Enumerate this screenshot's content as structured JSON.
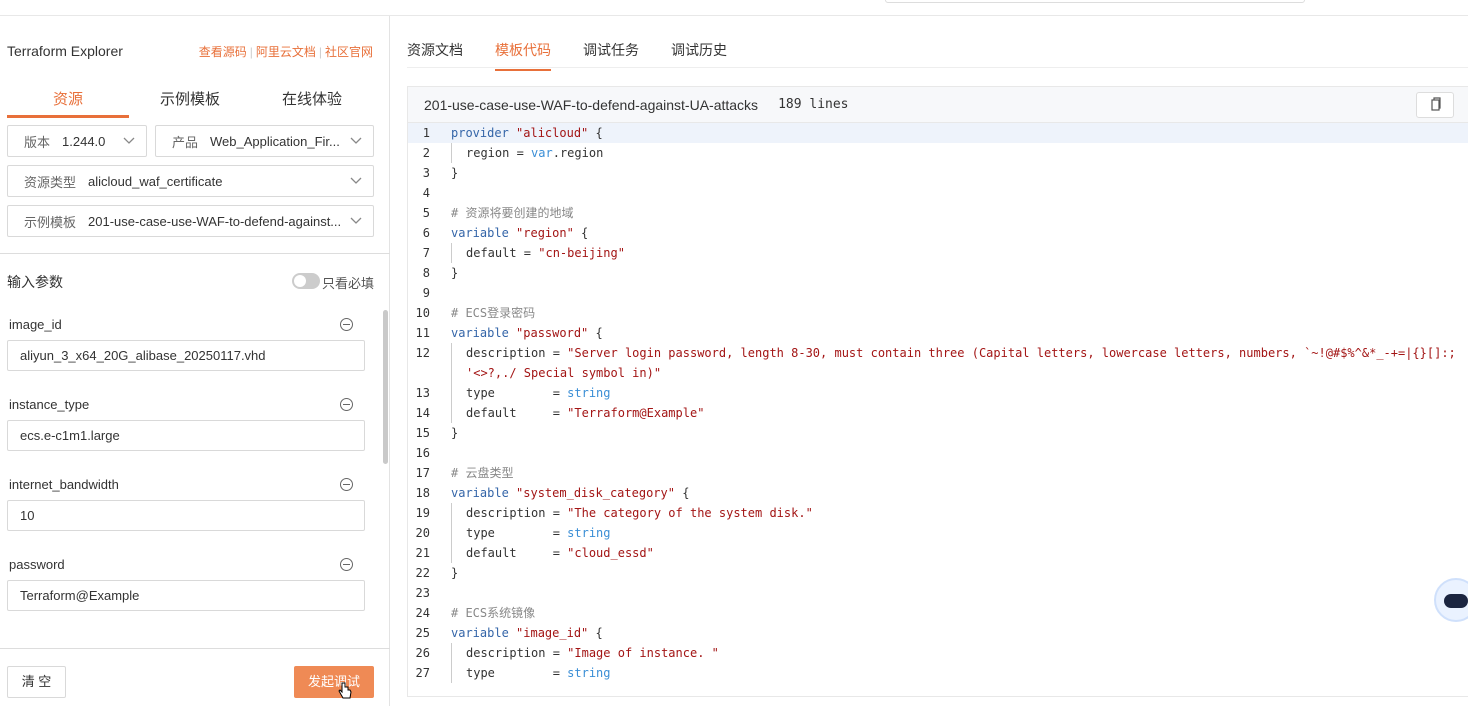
{
  "header": {
    "brand": "Terraform Explorer",
    "links": [
      "查看源码",
      "阿里云文档",
      "社区官网"
    ]
  },
  "left_tabs": [
    "资源",
    "示例模板",
    "在线体验"
  ],
  "selects": {
    "version": {
      "label": "版本",
      "value": "1.244.0"
    },
    "product": {
      "label": "产品",
      "value": "Web_Application_Fir..."
    },
    "resource_type": {
      "label": "资源类型",
      "value": "alicloud_waf_certificate"
    },
    "template": {
      "label": "示例模板",
      "value": "201-use-case-use-WAF-to-defend-against..."
    }
  },
  "params_section": {
    "title": "输入参数",
    "toggle_label": "只看必填"
  },
  "params": [
    {
      "name": "image_id",
      "value": "aliyun_3_x64_20G_alibase_20250117.vhd"
    },
    {
      "name": "instance_type",
      "value": "ecs.e-c1m1.large"
    },
    {
      "name": "internet_bandwidth",
      "value": "10"
    },
    {
      "name": "password",
      "value": "Terraform@Example"
    }
  ],
  "buttons": {
    "clear": "清 空",
    "run": "发起调试"
  },
  "right_tabs": [
    "资源文档",
    "模板代码",
    "调试任务",
    "调试历史"
  ],
  "code": {
    "file": "201-use-case-use-WAF-to-defend-against-UA-attacks",
    "line_count": "189 lines",
    "lines": [
      {
        "n": "1",
        "i": 0,
        "s": [
          {
            "c": "kw",
            "t": "provider "
          },
          {
            "c": "str",
            "t": "\"alicloud\""
          },
          {
            "c": "pl",
            "t": " {"
          }
        ]
      },
      {
        "n": "2",
        "i": 1,
        "s": [
          {
            "c": "pl",
            "t": "region = "
          },
          {
            "c": "typ",
            "t": "var"
          },
          {
            "c": "pl",
            "t": ".region"
          }
        ]
      },
      {
        "n": "3",
        "i": 0,
        "s": [
          {
            "c": "pl",
            "t": "}"
          }
        ]
      },
      {
        "n": "4",
        "i": 0,
        "s": []
      },
      {
        "n": "5",
        "i": 0,
        "s": [
          {
            "c": "cm",
            "t": "# 资源将要创建的地域"
          }
        ]
      },
      {
        "n": "6",
        "i": 0,
        "s": [
          {
            "c": "kw",
            "t": "variable "
          },
          {
            "c": "str",
            "t": "\"region\""
          },
          {
            "c": "pl",
            "t": " {"
          }
        ]
      },
      {
        "n": "7",
        "i": 1,
        "s": [
          {
            "c": "pl",
            "t": "default = "
          },
          {
            "c": "str",
            "t": "\"cn-beijing\""
          }
        ]
      },
      {
        "n": "8",
        "i": 0,
        "s": [
          {
            "c": "pl",
            "t": "}"
          }
        ]
      },
      {
        "n": "9",
        "i": 0,
        "s": []
      },
      {
        "n": "10",
        "i": 0,
        "s": [
          {
            "c": "cm",
            "t": "# ECS登录密码"
          }
        ]
      },
      {
        "n": "11",
        "i": 0,
        "s": [
          {
            "c": "kw",
            "t": "variable "
          },
          {
            "c": "str",
            "t": "\"password\""
          },
          {
            "c": "pl",
            "t": " {"
          }
        ]
      },
      {
        "n": "12",
        "i": 1,
        "s": [
          {
            "c": "pl",
            "t": "description = "
          },
          {
            "c": "str",
            "t": "\"Server login password, length 8-30, must contain three (Capital letters, lowercase letters, numbers, `~!@#$%^&*_-+=|{}[]:;"
          }
        ]
      },
      {
        "n": "",
        "i": 1,
        "s": [
          {
            "c": "str",
            "t": "'<>?,./ Special symbol in)\""
          }
        ]
      },
      {
        "n": "13",
        "i": 1,
        "s": [
          {
            "c": "pl",
            "t": "type        = "
          },
          {
            "c": "typ",
            "t": "string"
          }
        ]
      },
      {
        "n": "14",
        "i": 1,
        "s": [
          {
            "c": "pl",
            "t": "default     = "
          },
          {
            "c": "str",
            "t": "\"Terraform@Example\""
          }
        ]
      },
      {
        "n": "15",
        "i": 0,
        "s": [
          {
            "c": "pl",
            "t": "}"
          }
        ]
      },
      {
        "n": "16",
        "i": 0,
        "s": []
      },
      {
        "n": "17",
        "i": 0,
        "s": [
          {
            "c": "cm",
            "t": "# 云盘类型"
          }
        ]
      },
      {
        "n": "18",
        "i": 0,
        "s": [
          {
            "c": "kw",
            "t": "variable "
          },
          {
            "c": "str",
            "t": "\"system_disk_category\""
          },
          {
            "c": "pl",
            "t": " {"
          }
        ]
      },
      {
        "n": "19",
        "i": 1,
        "s": [
          {
            "c": "pl",
            "t": "description = "
          },
          {
            "c": "str",
            "t": "\"The category of the system disk.\""
          }
        ]
      },
      {
        "n": "20",
        "i": 1,
        "s": [
          {
            "c": "pl",
            "t": "type        = "
          },
          {
            "c": "typ",
            "t": "string"
          }
        ]
      },
      {
        "n": "21",
        "i": 1,
        "s": [
          {
            "c": "pl",
            "t": "default     = "
          },
          {
            "c": "str",
            "t": "\"cloud_essd\""
          }
        ]
      },
      {
        "n": "22",
        "i": 0,
        "s": [
          {
            "c": "pl",
            "t": "}"
          }
        ]
      },
      {
        "n": "23",
        "i": 0,
        "s": []
      },
      {
        "n": "24",
        "i": 0,
        "s": [
          {
            "c": "cm",
            "t": "# ECS系统镜像"
          }
        ]
      },
      {
        "n": "25",
        "i": 0,
        "s": [
          {
            "c": "kw",
            "t": "variable "
          },
          {
            "c": "str",
            "t": "\"image_id\""
          },
          {
            "c": "pl",
            "t": " {"
          }
        ]
      },
      {
        "n": "26",
        "i": 1,
        "s": [
          {
            "c": "pl",
            "t": "description = "
          },
          {
            "c": "str",
            "t": "\"Image of instance. \""
          }
        ]
      },
      {
        "n": "27",
        "i": 1,
        "s": [
          {
            "c": "pl",
            "t": "type        = "
          },
          {
            "c": "typ",
            "t": "string"
          }
        ]
      }
    ]
  },
  "colors": {
    "accent": "#e8703a",
    "button": "#ef8a55"
  }
}
